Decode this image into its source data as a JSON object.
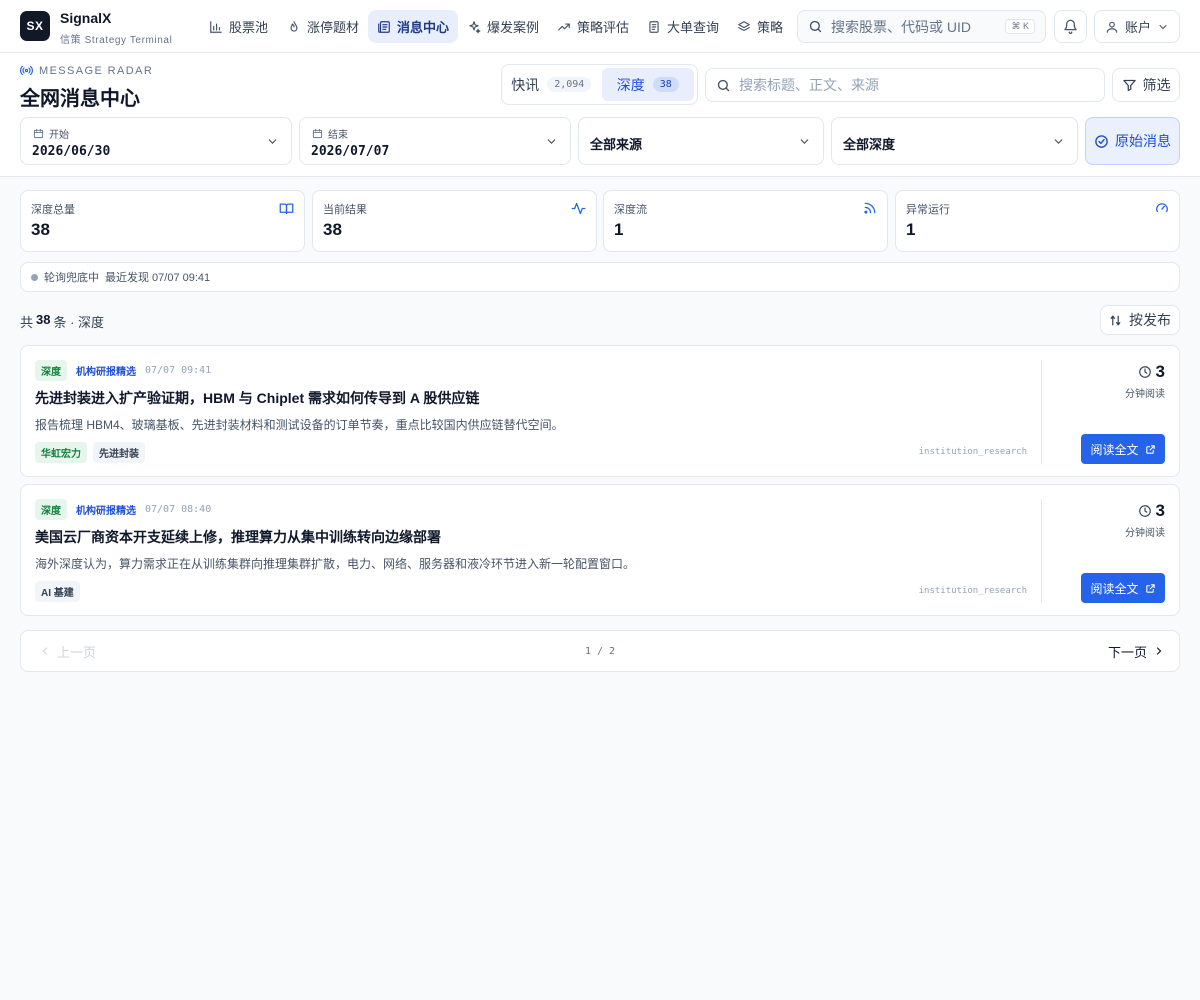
{
  "brand": {
    "logo_text": "SX",
    "name": "SignalX",
    "subtitle": "信策 Strategy Terminal"
  },
  "nav": {
    "items": [
      {
        "label": "股票池",
        "icon": "bar-chart-icon"
      },
      {
        "label": "涨停题材",
        "icon": "flame-icon"
      },
      {
        "label": "消息中心",
        "icon": "newspaper-icon",
        "active": true
      },
      {
        "label": "爆发案例",
        "icon": "sparkles-icon"
      },
      {
        "label": "策略评估",
        "icon": "trending-up-icon"
      },
      {
        "label": "大单查询",
        "icon": "document-icon"
      },
      {
        "label": "策略",
        "icon": "layers-icon"
      }
    ]
  },
  "search": {
    "placeholder": "搜索股票、代码或 UID",
    "shortcut": "⌘ K"
  },
  "account": {
    "label": "账户"
  },
  "header": {
    "eyebrow": "MESSAGE RADAR",
    "title": "全网消息中心"
  },
  "segments": [
    {
      "label": "快讯",
      "count": "2,094"
    },
    {
      "label": "深度",
      "count": "38",
      "active": true
    }
  ],
  "message_search": {
    "placeholder": "搜索标题、正文、来源"
  },
  "filter_button": {
    "label": "筛选"
  },
  "filters": {
    "start": {
      "label": "开始",
      "value": "2026/06/30"
    },
    "end": {
      "label": "结束",
      "value": "2026/07/07"
    },
    "source": {
      "value": "全部来源"
    },
    "depth": {
      "value": "全部深度"
    },
    "raw_button": "原始消息"
  },
  "stats": [
    {
      "label": "深度总量",
      "value": "38",
      "icon": "book-open-icon"
    },
    {
      "label": "当前结果",
      "value": "38",
      "icon": "activity-icon"
    },
    {
      "label": "深度流",
      "value": "1",
      "icon": "rss-icon"
    },
    {
      "label": "异常运行",
      "value": "1",
      "icon": "gauge-icon"
    }
  ],
  "status": {
    "text": "轮询兜底中",
    "last_found": "最近发现 07/07 09:41"
  },
  "results": {
    "prefix": "共",
    "count": "38",
    "suffix": "条 · 深度"
  },
  "sort": {
    "label": "按发布"
  },
  "articles": [
    {
      "badge": "深度",
      "source": "机构研报精选",
      "time": "07/07 09:41",
      "title": "先进封装进入扩产验证期，HBM 与 Chiplet 需求如何传导到 A 股供应链",
      "summary": "报告梳理 HBM4、玻璃基板、先进封装材料和测试设备的订单节奏，重点比较国内供应链替代空间。",
      "tags": [
        {
          "label": "华虹宏力",
          "style": "green"
        },
        {
          "label": "先进封装",
          "style": "gray"
        }
      ],
      "source_code": "institution_research",
      "read_minutes": "3",
      "read_unit": "分钟阅读",
      "read_button": "阅读全文"
    },
    {
      "badge": "深度",
      "source": "机构研报精选",
      "time": "07/07 08:40",
      "title": "美国云厂商资本开支延续上修，推理算力从集中训练转向边缘部署",
      "summary": "海外深度认为，算力需求正在从训练集群向推理集群扩散，电力、网络、服务器和液冷环节进入新一轮配置窗口。",
      "tags": [
        {
          "label": "AI 基建",
          "style": "gray"
        }
      ],
      "source_code": "institution_research",
      "read_minutes": "3",
      "read_unit": "分钟阅读",
      "read_button": "阅读全文"
    }
  ],
  "pagination": {
    "prev": "上一页",
    "indicator": "1 / 2",
    "next": "下一页"
  },
  "colors": {
    "accent": "#2563eb",
    "nav_active_bg": "#e8eefb",
    "depth_green": "#15803d",
    "logo_bg": "#111827"
  }
}
